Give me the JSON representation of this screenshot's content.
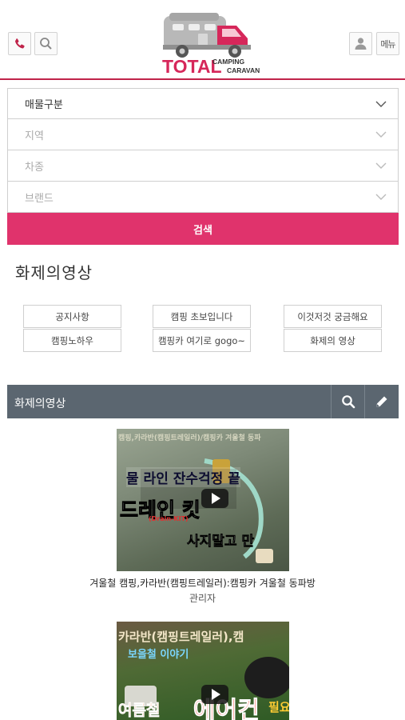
{
  "header": {
    "menu_label": "메뉴",
    "logo": {
      "brand": "TOTAL",
      "line1": "CAMPING",
      "line2": "CARAVAN"
    },
    "icons": [
      "phone-icon",
      "search-icon",
      "user-icon"
    ],
    "accent_color": "#c0244a"
  },
  "filters": {
    "property_type": "매물구분",
    "region": "지역",
    "vehicle_type": "차종",
    "brand": "브랜드",
    "search_label": "검색",
    "search_color": "#e0336c"
  },
  "section": {
    "title": "화제의영상"
  },
  "categories": [
    "공지사항",
    "캠핑 초보입니다",
    "이것저것 궁금해요",
    "캠핑노하우",
    "캠핑카 여기로 gogo~",
    "화제의 영상"
  ],
  "board": {
    "title": "화제의영상",
    "bar_color": "#5b6670"
  },
  "videos": [
    {
      "overlay_top": "캠핑,카라반(캠핑트레일러)/캠핑카 겨울철 동파",
      "overlay_line1": "물 라인 잔수걱정 끝",
      "overlay_line2": "드레인 킷",
      "overlay_line2b": "(Drain-KIT)",
      "overlay_line3": "사지말고 만",
      "caption": "겨울철 캠핑,카라반(캠핑트레일러):캠핑카 겨울철 동파방",
      "author": "관리자"
    },
    {
      "overlay_top": "카라반(캠핑트레일러),캠",
      "overlay_line1": "보을철 이야기",
      "overlay_line2": "여름철",
      "overlay_line3": "에어컨",
      "overlay_line4": "필요"
    }
  ]
}
